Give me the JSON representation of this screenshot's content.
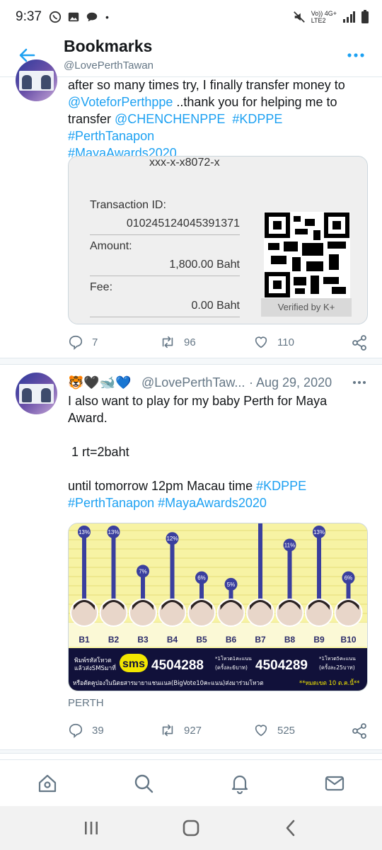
{
  "status_bar": {
    "time": "9:37",
    "signal_text": "Vo)) 4G+\nLTE2",
    "dot": "•"
  },
  "header": {
    "title": "Bookmarks",
    "handle": "@LovePerthTawan"
  },
  "tweet1": {
    "text_parts": [
      {
        "t": "after so many times try, I finally transfer money to\n"
      },
      {
        "t": "@VoteforPerthppe",
        "link": true
      },
      {
        "t": " ..thank you for helping me to\ntransfer "
      },
      {
        "t": "@CHENCHENPPE",
        "link": true
      },
      {
        "t": "  "
      },
      {
        "t": "#KDPPE",
        "link": true
      },
      {
        "t": " "
      },
      {
        "t": "#PerthTanapon",
        "link": true
      },
      {
        "t": "\n"
      },
      {
        "t": "#MayaAwards2020",
        "link": true
      }
    ],
    "receipt": {
      "account": "xxx-x-x8072-x",
      "transaction_label": "Transaction ID:",
      "transaction_id": "010245124045391371",
      "amount_label": "Amount:",
      "amount": "1,800.00 Baht",
      "fee_label": "Fee:",
      "fee": "0.00 Baht",
      "verified": "Verified by K+"
    },
    "replies": "7",
    "retweets": "96",
    "likes": "110"
  },
  "tweet2": {
    "emojis": "🐯🖤🐋💙",
    "handle": "@LovePerthTaw...",
    "date": "· Aug 29, 2020",
    "text_parts": [
      {
        "t": "I also want to play for my baby Perth for Maya\nAward.\n\n 1 rt=2baht\n\nuntil tomorrow 12pm Macau time "
      },
      {
        "t": "#KDPPE",
        "link": true
      },
      {
        "t": "\n"
      },
      {
        "t": "#PerthTanapon",
        "link": true
      },
      {
        "t": " "
      },
      {
        "t": "#MayaAwards2020",
        "link": true
      }
    ],
    "card_footer": "PERTH",
    "replies": "39",
    "retweets": "927",
    "likes": "525",
    "chart": {
      "sms_label": "sms",
      "sms_line1": "พิมพ์รหัสโหวต",
      "sms_line2": "แล้วส่งSMSมาที่",
      "number1": "4504288",
      "number1_note1": "*1โหวต1คะแนน",
      "number1_note2": "(ครั้งละ6บาท)",
      "number2": "4504289",
      "number2_note1": "*1โหวต5คะแนน",
      "number2_note2": "(ครั้งละ25บาท)",
      "footer_line": "หรือตัดคูปองในนิตยสารมายาแชนแนล(BigVote10คะแนน)ส่งมาร่วมโหวต",
      "footer_deadline": "**หมดเขต 10 ต.ค.นี้**"
    }
  },
  "chart_data": {
    "type": "bar",
    "categories": [
      "B1",
      "B2",
      "B3",
      "B4",
      "B5",
      "B6",
      "B7",
      "B8",
      "B9",
      "B10"
    ],
    "values": [
      13,
      13,
      7,
      12,
      6,
      5,
      null,
      11,
      13,
      6
    ],
    "value_labels": [
      "13%",
      "13%",
      "7%",
      "12%",
      "6%",
      "5%",
      "",
      "11%",
      "13%",
      "6%"
    ],
    "ylabel": "",
    "xlabel": "",
    "colors": {
      "bar": "#3a3f9e",
      "background": "#f7f3a4",
      "strip": "#11113a",
      "sms": "#f2e600"
    }
  },
  "colors": {
    "accent": "#1da1f2",
    "muted": "#657786",
    "text": "#14171a"
  },
  "icons": {
    "nav": [
      "home-icon",
      "search-icon",
      "notifications-icon",
      "messages-icon"
    ],
    "system": [
      "recents-icon",
      "home-button-icon",
      "back-icon"
    ]
  }
}
